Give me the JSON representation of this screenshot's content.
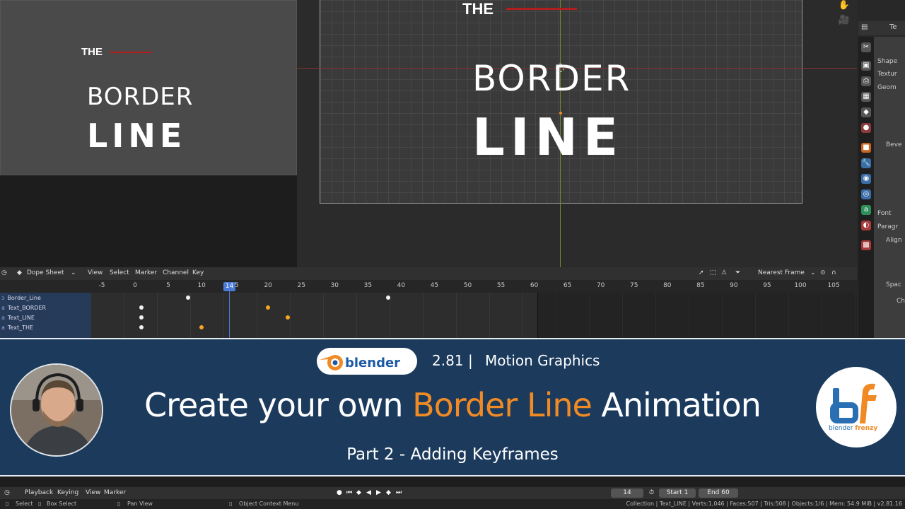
{
  "preview": {
    "the": "THE",
    "border": "BORDER",
    "line": "LINE"
  },
  "viewport": {
    "the": "THE",
    "border": "BORDER",
    "line": "LINE"
  },
  "properties": {
    "header_label": "Te",
    "rows": [
      "Shape",
      "Textur",
      "Geom",
      "Beve",
      "Font",
      "Paragr",
      "Align",
      "Spac",
      "Ch"
    ]
  },
  "dopesheet": {
    "editor_label": "Dope Sheet",
    "menus": [
      "View",
      "Select",
      "Marker",
      "Channel",
      "Key"
    ],
    "snap_mode": "Nearest Frame",
    "current_frame": "14",
    "ticks": [
      "-5",
      "0",
      "5",
      "10",
      "15",
      "20",
      "25",
      "30",
      "35",
      "40",
      "45",
      "50",
      "55",
      "60",
      "65",
      "70",
      "75",
      "80",
      "85",
      "90",
      "95",
      "100",
      "105"
    ],
    "channels": [
      "Border_Line",
      "Text_BORDER",
      "Text_LINE",
      "Text_THE"
    ],
    "keyframes": [
      {
        "channel": "Border_Line",
        "frame": 8,
        "kind": "white"
      },
      {
        "channel": "Border_Line",
        "frame": 38,
        "kind": "white"
      },
      {
        "channel": "Text_BORDER",
        "frame": 1,
        "kind": "white"
      },
      {
        "channel": "Text_BORDER",
        "frame": 20,
        "kind": "orange"
      },
      {
        "channel": "Text_LINE",
        "frame": 1,
        "kind": "white"
      },
      {
        "channel": "Text_LINE",
        "frame": 23,
        "kind": "orange"
      },
      {
        "channel": "Text_THE",
        "frame": 1,
        "kind": "white"
      },
      {
        "channel": "Text_THE",
        "frame": 10,
        "kind": "orange"
      }
    ]
  },
  "banner": {
    "version": "2.81",
    "separator": "|",
    "topic": "Motion Graphics",
    "title_pre": "Create your own ",
    "title_highlight": "Border Line",
    "title_post": " Animation",
    "subtitle": "Part 2 - Adding Keyframes",
    "brand_left": "blender",
    "brand_right": "frenzy"
  },
  "timeline": {
    "menus": [
      "Playback",
      "Keying",
      "View",
      "Marker"
    ],
    "current_frame": "14",
    "start_label": "Start",
    "start_value": "1",
    "end_label": "End",
    "end_value": "60"
  },
  "statusbar": {
    "select": "Select",
    "box_select": "Box Select",
    "pan_view": "Pan View",
    "context_menu": "Object Context Menu",
    "stats": "Collection | Text_LINE | Verts:1,046 | Faces:507 | Tris:508 | Objects:1/6 | Mem: 54.9 MiB | v2.81.16"
  },
  "colors": {
    "accent": "#f08a24",
    "banner_bg": "#1b3a5c",
    "playhead": "#4c7bd6",
    "key_white": "#f2f2f2",
    "key_selected": "#f5a623"
  }
}
